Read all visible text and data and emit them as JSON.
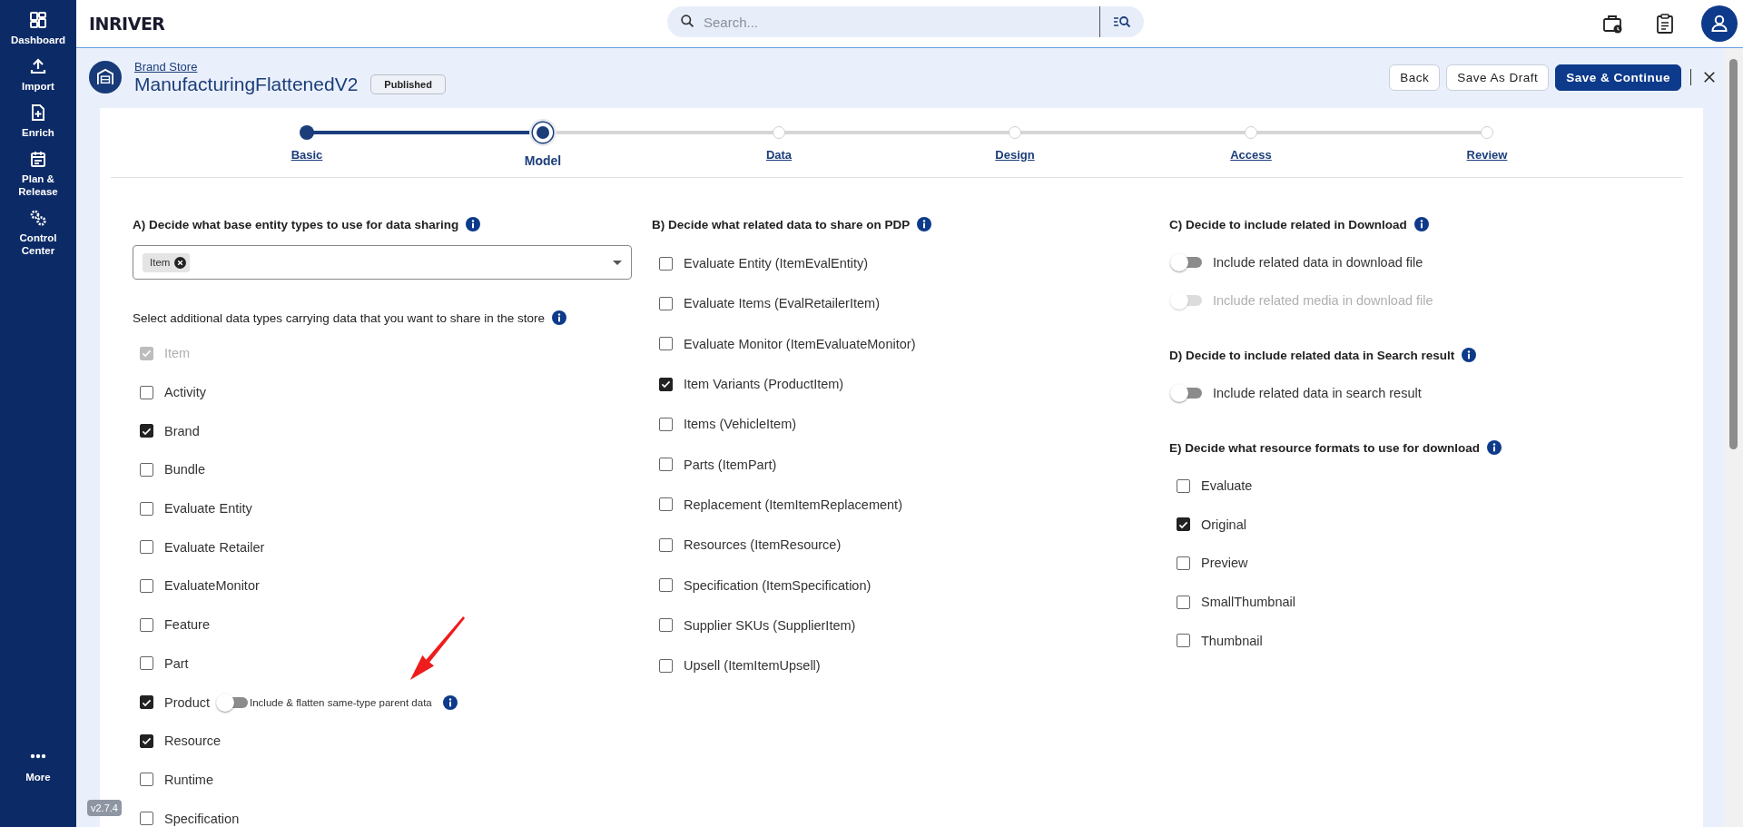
{
  "sidebar": {
    "items": [
      {
        "label": "Dashboard"
      },
      {
        "label": "Import"
      },
      {
        "label": "Enrich"
      },
      {
        "label": "Plan & Release"
      },
      {
        "label": "Control Center"
      }
    ],
    "more": {
      "label": "More"
    },
    "version": "v2.7.4"
  },
  "header": {
    "logo": "INRIVER",
    "search": {
      "placeholder": "Search..."
    }
  },
  "page": {
    "breadcrumb": "Brand Store",
    "title": "ManufacturingFlattenedV2",
    "status": "Published",
    "buttons": [
      {
        "label": "Back",
        "kind": "secondary"
      },
      {
        "label": "Save As Draft",
        "kind": "secondary"
      },
      {
        "label": "Save & Continue",
        "kind": "primary"
      }
    ]
  },
  "steps": [
    {
      "label": "Basic",
      "done": true,
      "selected": false
    },
    {
      "label": "Model",
      "done": false,
      "selected": true
    },
    {
      "label": "Data",
      "done": false,
      "selected": false
    },
    {
      "label": "Design",
      "done": false,
      "selected": false
    },
    {
      "label": "Access",
      "done": false,
      "selected": false
    },
    {
      "label": "Review",
      "done": false,
      "selected": false
    }
  ],
  "section_a": {
    "heading": "A) Decide what base entity types to use for data sharing",
    "selected_chips": [
      "Item"
    ],
    "hint": "Select additional data types carrying data that you want to share in the store",
    "items": [
      {
        "label": "Item",
        "checked": true,
        "disabled": true
      },
      {
        "label": "Activity",
        "checked": false,
        "disabled": false
      },
      {
        "label": "Brand",
        "checked": true,
        "disabled": false
      },
      {
        "label": "Bundle",
        "checked": false,
        "disabled": false
      },
      {
        "label": "Evaluate Entity",
        "checked": false,
        "disabled": false
      },
      {
        "label": "Evaluate Retailer",
        "checked": false,
        "disabled": false
      },
      {
        "label": "EvaluateMonitor",
        "checked": false,
        "disabled": false
      },
      {
        "label": "Feature",
        "checked": false,
        "disabled": false
      },
      {
        "label": "Part",
        "checked": false,
        "disabled": false
      },
      {
        "label": "Product",
        "checked": true,
        "disabled": false,
        "option": {
          "label": "Include & flatten same-type parent data",
          "on": false
        }
      },
      {
        "label": "Resource",
        "checked": true,
        "disabled": false
      },
      {
        "label": "Runtime",
        "checked": false,
        "disabled": false
      },
      {
        "label": "Specification",
        "checked": false,
        "disabled": false
      }
    ]
  },
  "section_b": {
    "heading": "B) Decide what related data to share on PDP",
    "items": [
      {
        "label": "Evaluate Entity (ItemEvalEntity)",
        "checked": false
      },
      {
        "label": "Evaluate Items (EvalRetailerItem)",
        "checked": false
      },
      {
        "label": "Evaluate Monitor (ItemEvaluateMonitor)",
        "checked": false
      },
      {
        "label": "Item Variants (ProductItem)",
        "checked": true
      },
      {
        "label": "Items (VehicleItem)",
        "checked": false
      },
      {
        "label": "Parts (ItemPart)",
        "checked": false
      },
      {
        "label": "Replacement (ItemItemReplacement)",
        "checked": false
      },
      {
        "label": "Resources (ItemResource)",
        "checked": false
      },
      {
        "label": "Specification (ItemSpecification)",
        "checked": false
      },
      {
        "label": "Supplier SKUs (SupplierItem)",
        "checked": false
      },
      {
        "label": "Upsell (ItemItemUpsell)",
        "checked": false
      }
    ]
  },
  "section_c": {
    "heading": "C) Decide to include related in Download",
    "toggles": [
      {
        "label": "Include related data in download file",
        "on": false,
        "disabled": false
      },
      {
        "label": "Include related media in download file",
        "on": false,
        "disabled": true
      }
    ]
  },
  "section_d": {
    "heading": "D) Decide to include related data in Search result",
    "toggles": [
      {
        "label": "Include related data in search result",
        "on": false,
        "disabled": false
      }
    ]
  },
  "section_e": {
    "heading": "E) Decide what resource formats to use for download",
    "items": [
      {
        "label": "Evaluate",
        "checked": false
      },
      {
        "label": "Original",
        "checked": true
      },
      {
        "label": "Preview",
        "checked": false
      },
      {
        "label": "SmallThumbnail",
        "checked": false
      },
      {
        "label": "Thumbnail",
        "checked": false
      }
    ]
  }
}
